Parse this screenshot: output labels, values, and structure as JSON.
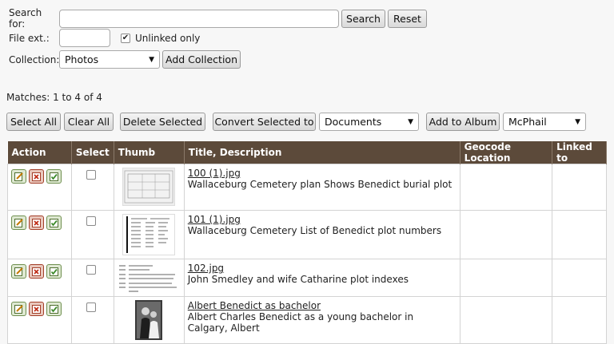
{
  "search": {
    "search_label": "Search for:",
    "search_value": "",
    "search_button": "Search",
    "reset_button": "Reset",
    "fileext_label": "File ext.:",
    "fileext_value": "",
    "unlinked_label": "Unlinked only",
    "unlinked_checked": true,
    "collection_label": "Collection:",
    "collection_selected": "Photos",
    "add_collection_button": "Add Collection"
  },
  "matches_text": "Matches: 1 to 4 of 4",
  "toolbar": {
    "select_all": "Select All",
    "clear_all": "Clear All",
    "delete_selected": "Delete Selected",
    "convert_selected": "Convert Selected to",
    "convert_target": "Documents",
    "add_to_album": "Add to Album",
    "album_selected": "McPhail"
  },
  "table": {
    "headers": [
      "Action",
      "Select",
      "Thumb",
      "Title, Description",
      "Geocode Location",
      "Linked to"
    ],
    "rows": [
      {
        "title": "100 (1).jpg",
        "description": "Wallaceburg Cemetery plan Shows Benedict burial plot",
        "thumb": "cemetery-plan"
      },
      {
        "title": "101 (1).jpg",
        "description": "Wallaceburg Cemetery List of Benedict plot numbers",
        "thumb": "plot-list"
      },
      {
        "title": "102.jpg",
        "description": "John Smedley and wife Catharine plot indexes",
        "thumb": "index-text"
      },
      {
        "title": "Albert Benedict as bachelor",
        "description": "Albert Charles Benedict as a young bachelor in Calgary, Albert",
        "thumb": "portrait-photo"
      }
    ]
  },
  "icons": {
    "edit": "edit-icon",
    "delete": "delete-icon",
    "approve": "approve-icon"
  },
  "colors": {
    "header_bg": "#5c4a3a",
    "page_bg": "#f7f7f7"
  }
}
